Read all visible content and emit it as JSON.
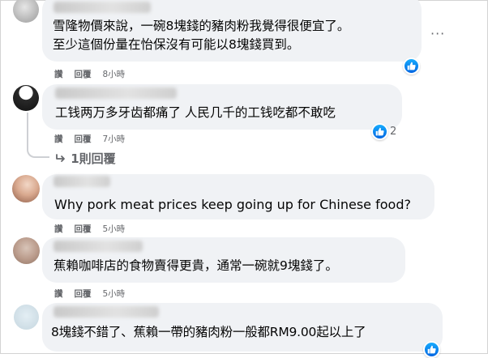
{
  "comments": [
    {
      "lines": [
        "雪隆物價來說，一碗8塊錢的豬肉粉我覺得很便宜了。",
        "至少這個份量在怡保沒有可能以8塊錢買到。"
      ],
      "actions": {
        "like": "讚",
        "reply": "回覆",
        "time": "8小時"
      },
      "more": "···"
    },
    {
      "lines": [
        "工钱两万多牙齿都痛了 人民几千的工钱吃都不敢吃"
      ],
      "actions": {
        "like": "讚",
        "reply": "回覆",
        "time": "7小時"
      },
      "reactions": "2",
      "replies": "1則回覆"
    },
    {
      "lines": [
        "Why pork meat prices keep going up for Chinese food?"
      ],
      "actions": {
        "like": "讚",
        "reply": "回覆",
        "time": "5小時"
      }
    },
    {
      "lines": [
        "蕉賴咖啡店的食物賣得更貴，通常一碗就9塊錢了。"
      ],
      "actions": {
        "like": "讚",
        "reply": "回覆",
        "time": "5小時"
      }
    },
    {
      "lines": [
        "8塊錢不錯了、蕉賴一帶的豬肉粉一般都RM9.00起以上了"
      ]
    }
  ],
  "colors": {
    "bubble": "#f0f2f5",
    "like_blue": "#0866ff",
    "meta": "#65676b"
  },
  "icons": {
    "like": "thumbs-up-icon",
    "reply_arrow": "reply-arrow-icon",
    "more": "more-icon"
  }
}
